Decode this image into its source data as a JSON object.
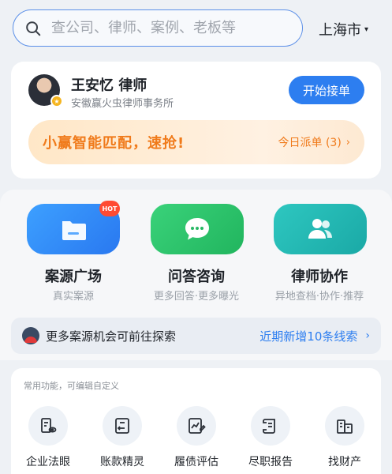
{
  "search": {
    "placeholder": "查公司、律师、案例、老板等"
  },
  "location": {
    "city": "上海市"
  },
  "lawyer": {
    "name": "王安忆 律师",
    "firm": "安徽赢火虫律师事务所",
    "start_button": "开始接单"
  },
  "promo": {
    "text": "小赢智能匹配，速抢!",
    "link": "今日派单 (3)"
  },
  "features": [
    {
      "title": "案源广场",
      "subtitle": "真实案源",
      "badge": "HOT",
      "icon": "folder-icon"
    },
    {
      "title": "问答咨询",
      "subtitle": "更多回答·更多曝光",
      "icon": "chat-bubble-icon"
    },
    {
      "title": "律师协作",
      "subtitle": "异地查档·协作·推荐",
      "icon": "users-icon"
    }
  ],
  "explore": {
    "text": "更多案源机会可前往探索",
    "link": "近期新增10条线索"
  },
  "tools": {
    "hint": "常用功能，可编辑自定义",
    "items": [
      {
        "label": "企业法眼",
        "icon": "company-eye-icon"
      },
      {
        "label": "账款精灵",
        "icon": "receipt-icon"
      },
      {
        "label": "履债评估",
        "icon": "chart-edit-icon"
      },
      {
        "label": "尽职报告",
        "icon": "scroll-report-icon"
      },
      {
        "label": "找财产",
        "icon": "buildings-icon"
      }
    ]
  },
  "colors": {
    "accent": "#2d7ef0",
    "promo": "#f07a1a",
    "feature_blue": "#2978f0",
    "feature_green": "#21b55e",
    "feature_teal": "#1aa9a6"
  }
}
